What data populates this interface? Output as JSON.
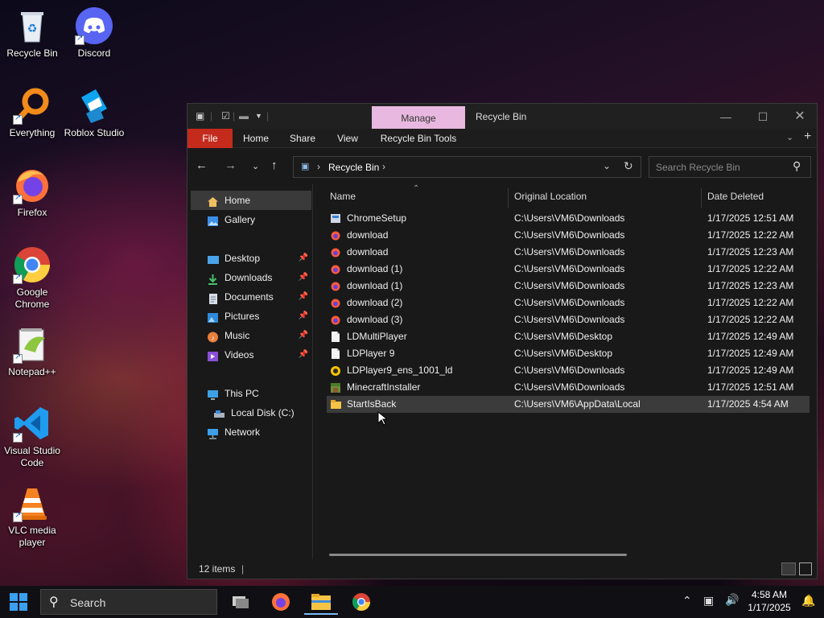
{
  "desktop": {
    "icons": [
      {
        "label": "Recycle Bin"
      },
      {
        "label": "Discord"
      },
      {
        "label": "Everything"
      },
      {
        "label": "Roblox Studio"
      },
      {
        "label": "Firefox"
      },
      {
        "label": "Google Chrome"
      },
      {
        "label": "Notepad++"
      },
      {
        "label": "Visual Studio Code"
      },
      {
        "label": "VLC media player"
      }
    ]
  },
  "window": {
    "title": "Recycle Bin",
    "manage_tab": "Manage",
    "ribbon": {
      "file": "File",
      "home": "Home",
      "share": "Share",
      "view": "View",
      "tools": "Recycle Bin Tools"
    },
    "address": {
      "path": "Recycle Bin"
    },
    "search": {
      "placeholder": "Search Recycle Bin"
    },
    "nav": {
      "home": "Home",
      "gallery": "Gallery",
      "desktop": "Desktop",
      "downloads": "Downloads",
      "documents": "Documents",
      "pictures": "Pictures",
      "music": "Music",
      "videos": "Videos",
      "this_pc": "This PC",
      "local_disk": "Local Disk (C:)",
      "network": "Network"
    },
    "columns": {
      "name": "Name",
      "location": "Original Location",
      "date": "Date Deleted"
    },
    "files": [
      {
        "name": "ChromeSetup",
        "location": "C:\\Users\\VM6\\Downloads",
        "date": "1/17/2025 12:51 AM",
        "icon": "installer-icon"
      },
      {
        "name": "download",
        "location": "C:\\Users\\VM6\\Downloads",
        "date": "1/17/2025 12:22 AM",
        "icon": "firefox-file-icon"
      },
      {
        "name": "download",
        "location": "C:\\Users\\VM6\\Downloads",
        "date": "1/17/2025 12:23 AM",
        "icon": "firefox-file-icon"
      },
      {
        "name": "download (1)",
        "location": "C:\\Users\\VM6\\Downloads",
        "date": "1/17/2025 12:22 AM",
        "icon": "firefox-file-icon"
      },
      {
        "name": "download (1)",
        "location": "C:\\Users\\VM6\\Downloads",
        "date": "1/17/2025 12:23 AM",
        "icon": "firefox-file-icon"
      },
      {
        "name": "download (2)",
        "location": "C:\\Users\\VM6\\Downloads",
        "date": "1/17/2025 12:22 AM",
        "icon": "firefox-file-icon"
      },
      {
        "name": "download (3)",
        "location": "C:\\Users\\VM6\\Downloads",
        "date": "1/17/2025 12:22 AM",
        "icon": "firefox-file-icon"
      },
      {
        "name": "LDMultiPlayer",
        "location": "C:\\Users\\VM6\\Desktop",
        "date": "1/17/2025 12:49 AM",
        "icon": "shortcut-file-icon"
      },
      {
        "name": "LDPlayer 9",
        "location": "C:\\Users\\VM6\\Desktop",
        "date": "1/17/2025 12:49 AM",
        "icon": "shortcut-file-icon"
      },
      {
        "name": "LDPlayer9_ens_1001_ld",
        "location": "C:\\Users\\VM6\\Downloads",
        "date": "1/17/2025 12:49 AM",
        "icon": "ldplayer-icon"
      },
      {
        "name": "MinecraftInstaller",
        "location": "C:\\Users\\VM6\\Downloads",
        "date": "1/17/2025 12:51 AM",
        "icon": "minecraft-icon"
      },
      {
        "name": "StartIsBack",
        "location": "C:\\Users\\VM6\\AppData\\Local",
        "date": "1/17/2025 4:54 AM",
        "icon": "folder-icon"
      }
    ],
    "status": {
      "count": "12 items"
    }
  },
  "taskbar": {
    "search_label": "Search",
    "clock": {
      "time": "4:58 AM",
      "date": "1/17/2025"
    }
  },
  "colors": {
    "accent": "#c42b1c",
    "manage_tab": "#e8b8e0",
    "selection": "#3b3b3b"
  }
}
